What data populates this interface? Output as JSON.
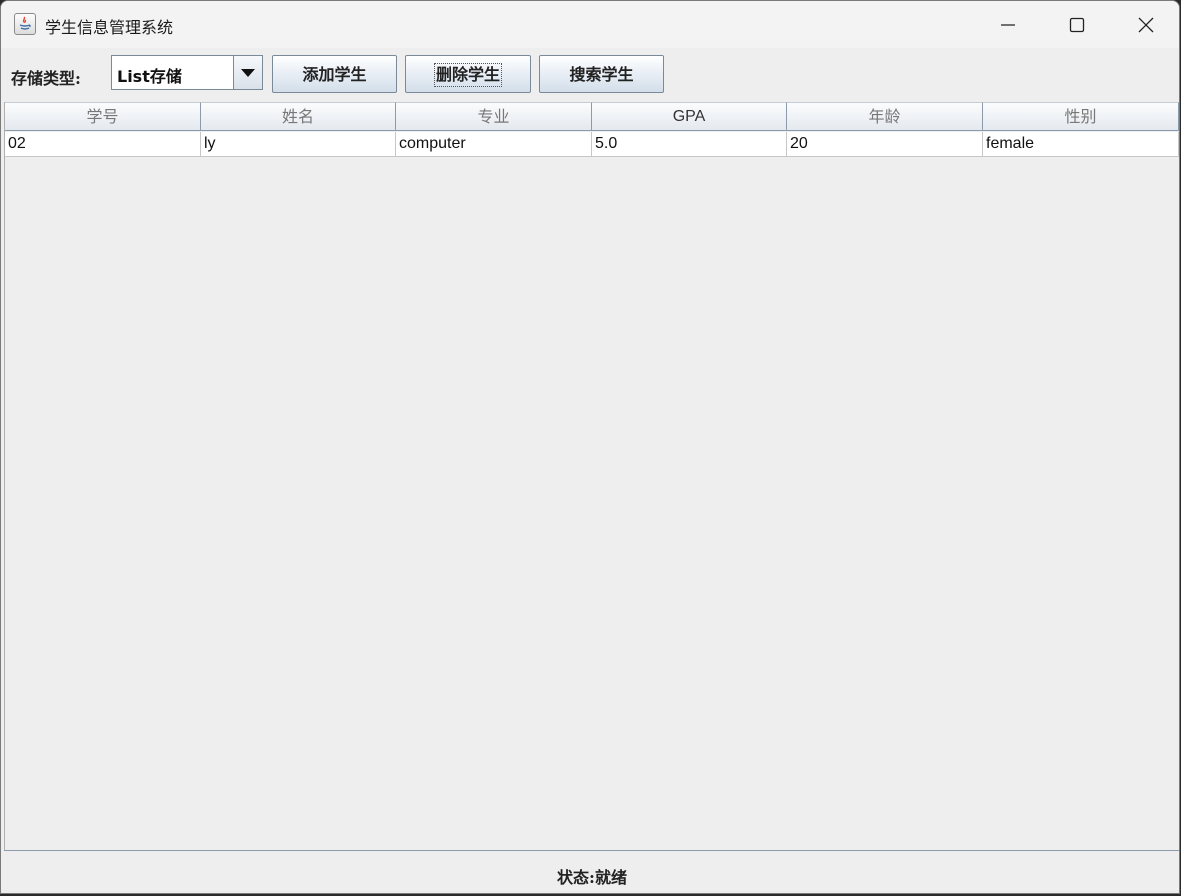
{
  "window": {
    "title": "学生信息管理系统",
    "icons": {
      "app": "java-app-icon",
      "minimize": "minimize-icon",
      "maximize": "maximize-icon",
      "close": "close-icon"
    }
  },
  "toolbar": {
    "storage_label": "存储类型:",
    "storage_type": {
      "selected": "List存储",
      "arrow_icon": "chevron-down-icon"
    },
    "buttons": {
      "add": "添加学生",
      "delete": "删除学生",
      "search": "搜索学生"
    }
  },
  "table": {
    "columns": [
      "学号",
      "姓名",
      "专业",
      "GPA",
      "年龄",
      "性别"
    ],
    "rows": [
      [
        "02",
        "ly",
        "computer",
        "5.0",
        "20",
        "female"
      ]
    ]
  },
  "status": {
    "text": "状态:就绪"
  },
  "colors": {
    "window_bg": "#eeeeee",
    "titlebar_bg": "#f3f3f3",
    "header_border": "#8c9bab"
  }
}
